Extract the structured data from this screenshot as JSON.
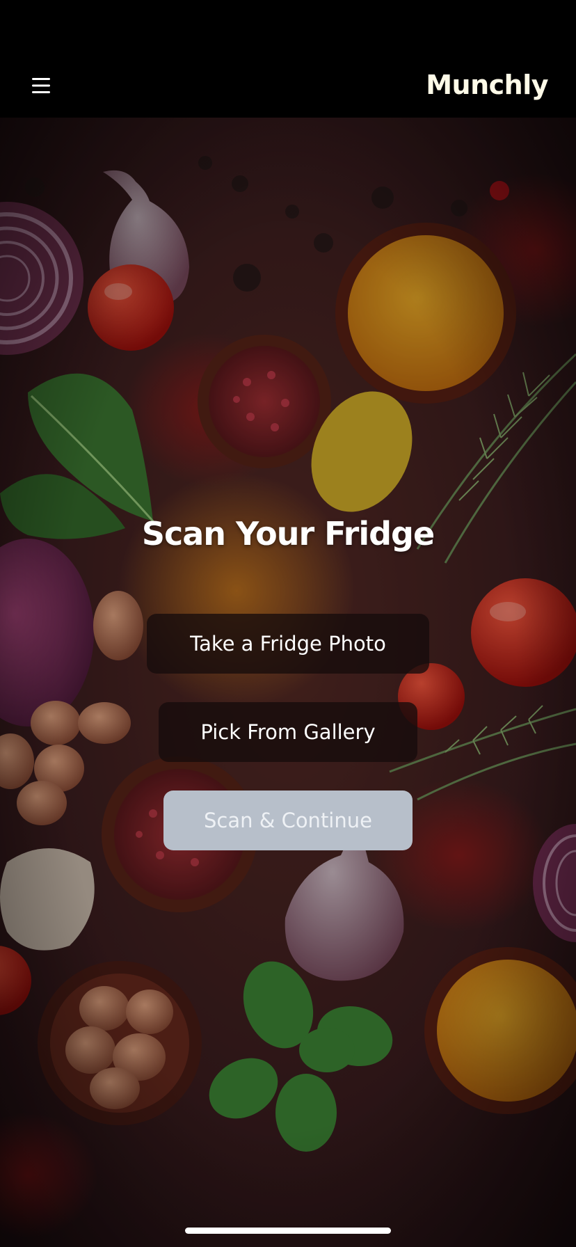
{
  "app_bar": {
    "menu_icon": "hamburger-menu-icon",
    "brand": "Munchly"
  },
  "background": {
    "description_icon": "food-ingredients-background",
    "base_color": "#3a1e20"
  },
  "main": {
    "title": "Scan Your Fridge",
    "buttons": {
      "take_photo": "Take a Fridge Photo",
      "pick_gallery": "Pick From Gallery",
      "scan_continue": "Scan & Continue"
    }
  },
  "colors": {
    "brand_text": "#fffbe8",
    "dark_button": "#160c0c",
    "disabled_button": "#b7bfca"
  }
}
